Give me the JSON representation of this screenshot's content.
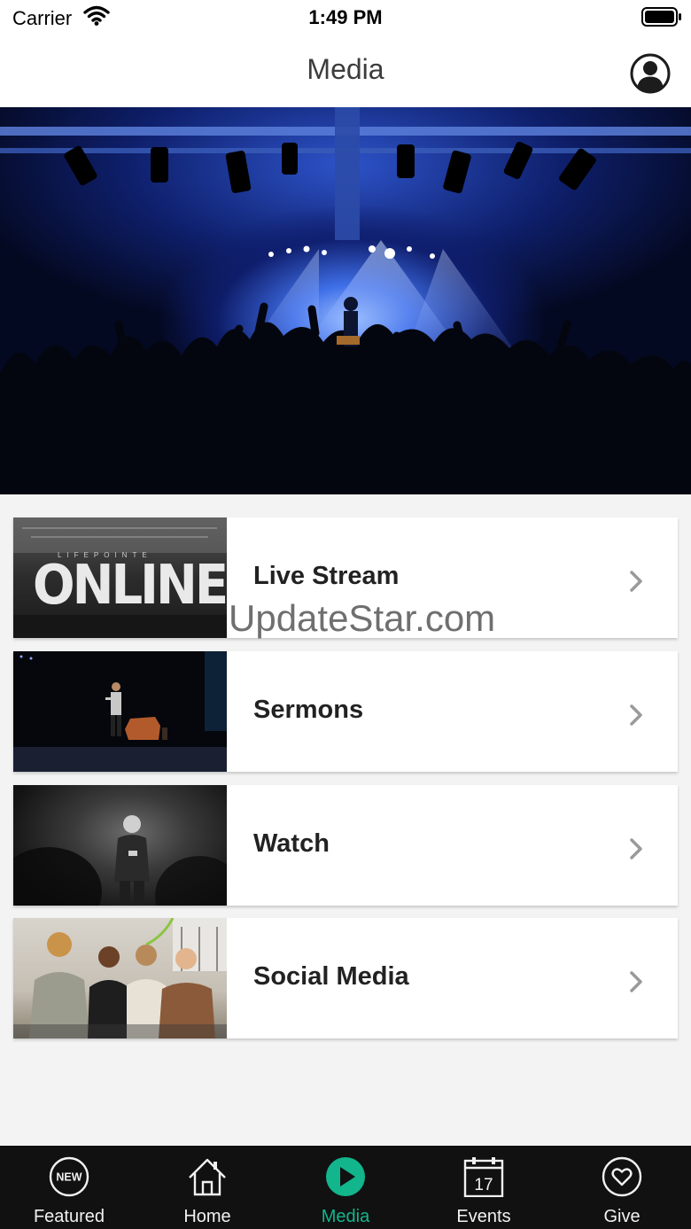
{
  "status_bar": {
    "carrier": "Carrier",
    "time": "1:49 PM"
  },
  "nav": {
    "title": "Media",
    "profile_icon": "person-circle-icon"
  },
  "watermark": "UpdateStar.com",
  "cards": [
    {
      "label": "Live Stream",
      "thumbnail_text": "ONLINE"
    },
    {
      "label": "Sermons"
    },
    {
      "label": "Watch"
    },
    {
      "label": "Social Media"
    }
  ],
  "tabs": [
    {
      "label": "Featured",
      "icon": "new-badge-icon",
      "icon_text": "NEW"
    },
    {
      "label": "Home",
      "icon": "house-icon"
    },
    {
      "label": "Media",
      "icon": "play-icon",
      "active": true
    },
    {
      "label": "Events",
      "icon": "calendar-icon",
      "icon_text": "17"
    },
    {
      "label": "Give",
      "icon": "heart-icon"
    }
  ],
  "colors": {
    "accent": "#12b58c",
    "tab_bar": "#111111",
    "background": "#f3f3f4"
  }
}
